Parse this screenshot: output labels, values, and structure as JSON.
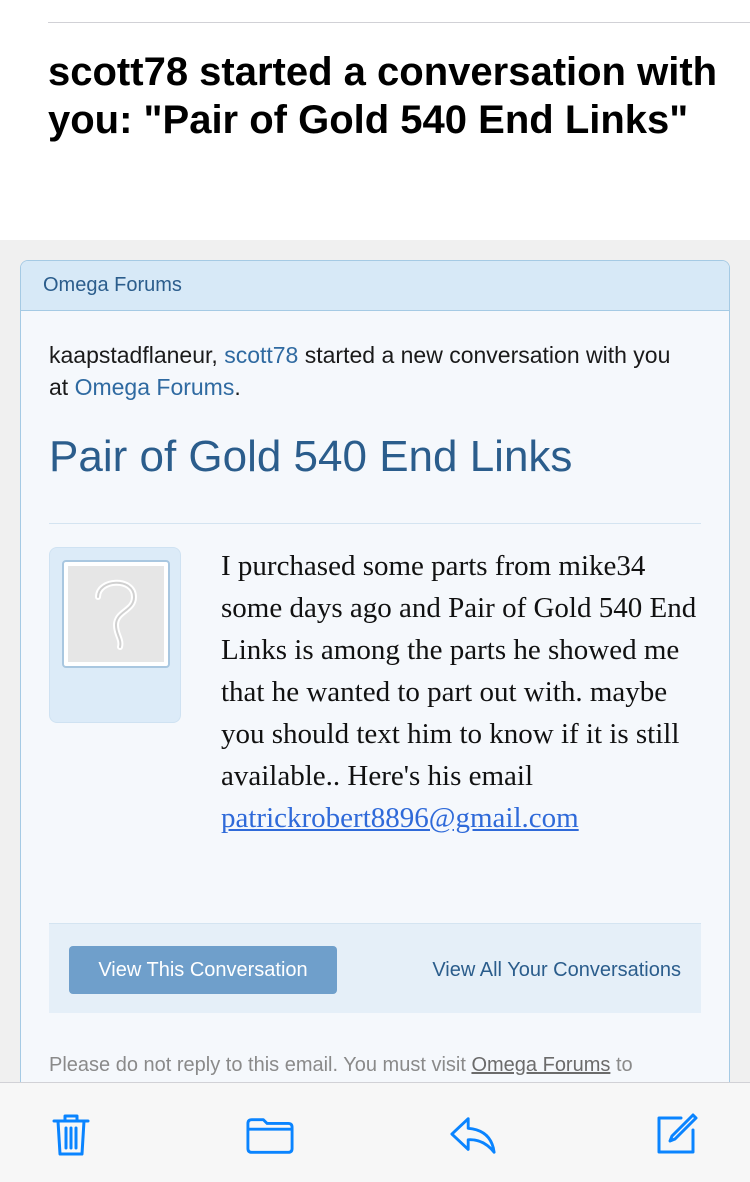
{
  "email": {
    "subject": "scott78 started a conversation with you: \"Pair of Gold 540 End Links\""
  },
  "card": {
    "header": "Omega Forums",
    "intro": {
      "greeting": "kaapstadflaneur, ",
      "sender": "scott78",
      "middle": " started a new conversation with you at ",
      "forum_link": "Omega Forums",
      "end": "."
    },
    "title": "Pair of Gold 540 End Links",
    "avatar_icon": "placeholder-avatar-question-mark",
    "message_text": "I purchased some parts from mike34 some days ago and Pair of Gold 540 End Links is among the parts he showed me that he wanted to part out with. maybe you should text him to know if it is still available.. Here's his email",
    "message_email": "patrickrobert8896@gmail.com",
    "view_button": "View This Conversation",
    "view_all_link": "View All Your Conversations",
    "footer": {
      "before": "Please do not reply to this email. You must visit ",
      "link": "Omega Forums",
      "after": " to"
    }
  },
  "toolbar": {
    "icons": [
      "trash-icon",
      "folder-icon",
      "reply-icon",
      "compose-icon"
    ],
    "accent_color": "#0a84ff"
  }
}
